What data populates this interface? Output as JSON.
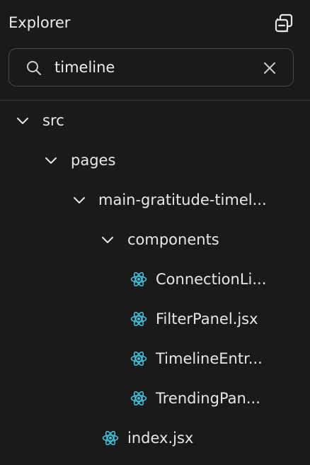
{
  "panel": {
    "title": "Explorer",
    "collapse_icon": "collapse-all-icon"
  },
  "search": {
    "value": "timeline",
    "icon": "search-icon",
    "clear_icon": "close-icon"
  },
  "colors": {
    "background": "#1a1a1a",
    "react_icon": "#3fc1d9",
    "text": "#e8e8e8"
  },
  "tree": {
    "items": [
      {
        "label": "src",
        "type": "folder",
        "expanded": true,
        "icon": "chevron-down-icon"
      },
      {
        "label": "pages",
        "type": "folder",
        "expanded": true,
        "icon": "chevron-down-icon"
      },
      {
        "label": "main-gratitude-timel...",
        "type": "folder",
        "expanded": true,
        "icon": "chevron-down-icon"
      },
      {
        "label": "components",
        "type": "folder",
        "expanded": true,
        "icon": "chevron-down-icon"
      },
      {
        "label": "ConnectionLi...",
        "type": "file",
        "icon": "react-icon"
      },
      {
        "label": "FilterPanel.jsx",
        "type": "file",
        "icon": "react-icon"
      },
      {
        "label": "TimelineEntr...",
        "type": "file",
        "icon": "react-icon"
      },
      {
        "label": "TrendingPan...",
        "type": "file",
        "icon": "react-icon"
      },
      {
        "label": "index.jsx",
        "type": "file",
        "icon": "react-icon"
      }
    ]
  }
}
